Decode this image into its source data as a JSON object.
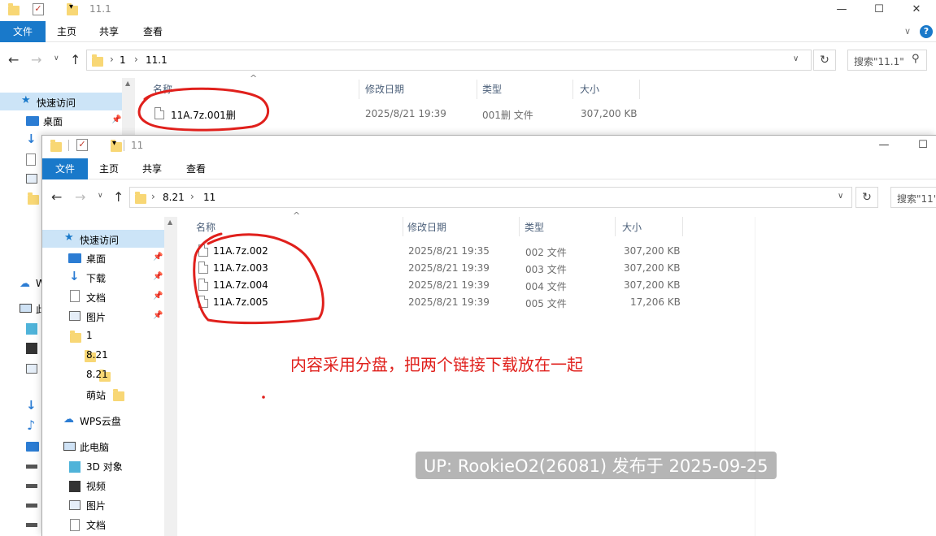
{
  "back_window": {
    "title": "11.1",
    "tabs": [
      "文件",
      "主页",
      "共享",
      "查看"
    ],
    "breadcrumb": [
      "1",
      "11.1"
    ],
    "search_placeholder": "搜索\"11.1\"",
    "columns": [
      "名称",
      "修改日期",
      "类型",
      "大小"
    ],
    "files": [
      {
        "name": "11A.7z.001删",
        "date": "2025/8/21 19:39",
        "type": "001删 文件",
        "size": "307,200 KB"
      }
    ],
    "sidebar": {
      "quick_access": "快速访问",
      "items": [
        "桌面"
      ]
    },
    "side_partial": [
      "W",
      "此"
    ]
  },
  "front_window": {
    "title": "11",
    "tabs": [
      "文件",
      "主页",
      "共享",
      "查看"
    ],
    "breadcrumb": [
      "8.21",
      "11"
    ],
    "search_placeholder": "搜索\"11\"",
    "columns": [
      "名称",
      "修改日期",
      "类型",
      "大小"
    ],
    "files": [
      {
        "name": "11A.7z.002",
        "date": "2025/8/21 19:35",
        "type": "002 文件",
        "size": "307,200 KB"
      },
      {
        "name": "11A.7z.003",
        "date": "2025/8/21 19:39",
        "type": "003 文件",
        "size": "307,200 KB"
      },
      {
        "name": "11A.7z.004",
        "date": "2025/8/21 19:39",
        "type": "004 文件",
        "size": "307,200 KB"
      },
      {
        "name": "11A.7z.005",
        "date": "2025/8/21 19:39",
        "type": "005 文件",
        "size": "17,206 KB"
      }
    ],
    "sidebar": {
      "quick_access": "快速访问",
      "items": [
        "桌面",
        "下载",
        "文档",
        "图片",
        "1",
        "8.21",
        "8.21",
        "萌站"
      ],
      "wps": "WPS云盘",
      "this_pc": "此电脑",
      "pc_items": [
        "3D 对象",
        "视频",
        "图片",
        "文档"
      ]
    }
  },
  "annotation": "内容采用分盘，把两个链接下载放在一起",
  "watermark": "UP: RookieO2(26081) 发布于 2025-09-25",
  "colors": {
    "accent": "#1979ca",
    "annotation": "#e0201c",
    "header_text": "#4c607a"
  }
}
